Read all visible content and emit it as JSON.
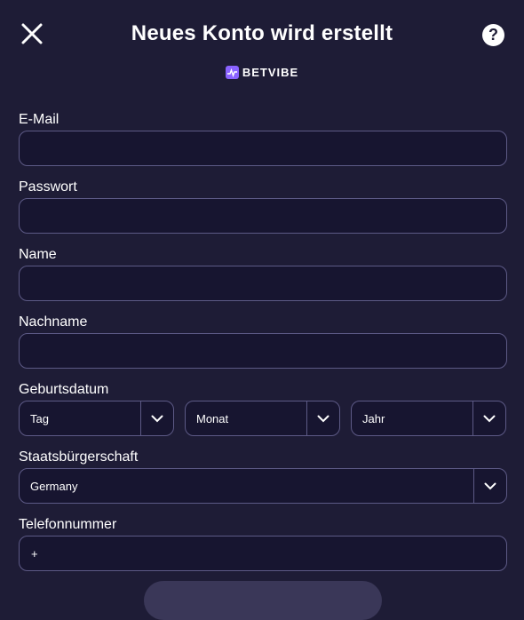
{
  "header": {
    "title": "Neues Konto wird erstellt",
    "close_icon": "close-icon",
    "help_icon": "help-icon",
    "help_glyph": "?"
  },
  "brand": {
    "logo_text": "BETVIBE",
    "accent": "#8a63ff"
  },
  "form": {
    "email": {
      "label": "E-Mail",
      "value": ""
    },
    "password": {
      "label": "Passwort",
      "value": ""
    },
    "name": {
      "label": "Name",
      "value": ""
    },
    "lastname": {
      "label": "Nachname",
      "value": ""
    },
    "birthdate": {
      "label": "Geburtsdatum",
      "day": "Tag",
      "month": "Monat",
      "year": "Jahr"
    },
    "citizenship": {
      "label": "Staatsbürgerschaft",
      "value": "Germany"
    },
    "phone": {
      "label": "Telefonnummer",
      "value": "+"
    }
  },
  "colors": {
    "background": "#1e1c36",
    "field_background": "#171530",
    "field_border": "#5d5a86"
  }
}
